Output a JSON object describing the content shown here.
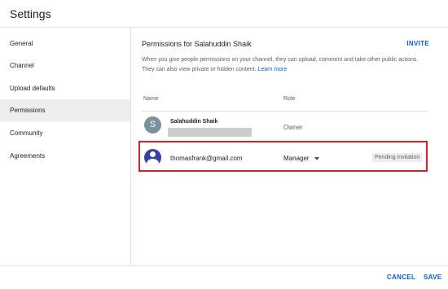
{
  "window": {
    "title": "Settings"
  },
  "sidebar": {
    "items": [
      {
        "label": "General"
      },
      {
        "label": "Channel"
      },
      {
        "label": "Upload defaults"
      },
      {
        "label": "Permissions"
      },
      {
        "label": "Community"
      },
      {
        "label": "Agreements"
      }
    ],
    "active": "Permissions"
  },
  "permissions": {
    "title": "Permissions for Salahuddin Shaik",
    "invite_label": "INVITE",
    "description": "When you give people permissions on your channel, they can upload, comment and take other public actions. They can also view private or hidden content.",
    "learn_more": "Learn more",
    "columns": {
      "name": "Name",
      "role": "Role"
    },
    "rows": [
      {
        "avatar_letter": "S",
        "name": "Salahuddin Shaik",
        "role": "Owner"
      },
      {
        "email": "thomasfrank@gmail.com",
        "role": "Manager",
        "status": "Pending invitation"
      }
    ]
  },
  "footer": {
    "cancel_label": "CANCEL",
    "save_label": "SAVE"
  },
  "colors": {
    "accent": "#065fd4",
    "highlight_border": "#e31b23",
    "avatar_owner": "#7b8f9c",
    "avatar_user": "#3a3fa6"
  },
  "icons": {
    "role_dropdown": "caret-down-icon",
    "user_avatar": "person-icon"
  }
}
